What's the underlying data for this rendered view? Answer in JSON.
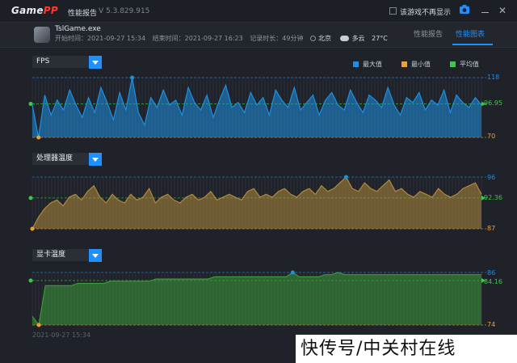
{
  "titlebar": {
    "logo_main": "Game",
    "logo_accent": "PP",
    "app_title": "性能报告",
    "version": "V 5.3.829.915",
    "dont_show_label": "该游戏不再显示",
    "icons": [
      "camera-icon",
      "minimize-icon",
      "close-icon"
    ]
  },
  "session": {
    "game_name": "TslGame.exe",
    "start_time": "开始时间：2021-09-27 15:34",
    "end_time": "结束时间：2021-09-27 16:23",
    "duration": "记录时长：49分钟",
    "city": "北京",
    "weather": "多云",
    "temperature": "27°C"
  },
  "tabs": [
    {
      "label": "性能报告",
      "active": false
    },
    {
      "label": "性能图表",
      "active": true
    }
  ],
  "legend": [
    {
      "label": "最大值",
      "color": "#1e8fe1"
    },
    {
      "label": "最小值",
      "color": "#f0a032"
    },
    {
      "label": "平均值",
      "color": "#3cc84a"
    }
  ],
  "footer_timestamp": "2021-09-27 15:34",
  "watermark": "快传号/中关村在线",
  "chart_data": [
    {
      "type": "area",
      "selector_label": "FPS",
      "color": "#1e8fe1",
      "max": 118,
      "min": 70,
      "avg": 96.95,
      "max_label": "118",
      "min_label": "70",
      "avg_label": "96.95",
      "ylim": [
        70,
        118
      ],
      "values": [
        96,
        70,
        104,
        88,
        100,
        92,
        108,
        96,
        86,
        102,
        90,
        110,
        98,
        84,
        106,
        92,
        118,
        90,
        80,
        102,
        94,
        108,
        96,
        100,
        88,
        110,
        98,
        92,
        104,
        86,
        100,
        112,
        94,
        98,
        90,
        106,
        96,
        102,
        88,
        108,
        100,
        94,
        110,
        92,
        98,
        104,
        88,
        100,
        106,
        96,
        92,
        108,
        98,
        90,
        104,
        100,
        94,
        110,
        96,
        88,
        102,
        98,
        106,
        92,
        100,
        96,
        108,
        90,
        104,
        98,
        94,
        102,
        96
      ]
    },
    {
      "type": "area",
      "selector_label": "处理器温度",
      "color": "#b08a3c",
      "max": 96,
      "min": 87,
      "avg": 92.36,
      "max_label": "96",
      "min_label": "87",
      "avg_label": "92.36",
      "ylim": [
        87,
        96
      ],
      "values": [
        87,
        89,
        90.5,
        91.5,
        92,
        91,
        92.5,
        93,
        92,
        93.5,
        94.5,
        92.5,
        91.5,
        93,
        92,
        91.5,
        93,
        92,
        92.5,
        94,
        91.5,
        92.5,
        93,
        92,
        91.5,
        92.5,
        93,
        92,
        92.5,
        93.5,
        92,
        92.5,
        93,
        92.5,
        92,
        93.5,
        94,
        92.5,
        93,
        92.5,
        93.5,
        94,
        93,
        92.5,
        93.5,
        94,
        93,
        94.5,
        93.5,
        94,
        95,
        96,
        94,
        93.5,
        95,
        94,
        93.5,
        94.5,
        95.5,
        93.5,
        94,
        93,
        92.5,
        93.5,
        93,
        92.5,
        94,
        93,
        92.5,
        93,
        94,
        94.5,
        95,
        93
      ]
    },
    {
      "type": "area",
      "selector_label": "显卡温度",
      "color": "#3a9a3a",
      "max": 86,
      "min": 74,
      "avg": 84.16,
      "max_label": "86",
      "min_label": "74",
      "avg_label": "84.16",
      "ylim": [
        74,
        86
      ],
      "values": [
        76,
        74,
        83,
        83,
        83,
        83,
        83,
        83.5,
        83.5,
        83.5,
        83.5,
        83.5,
        84,
        84,
        84,
        84,
        84,
        84,
        84,
        84.5,
        84.5,
        84.5,
        84.5,
        84.5,
        84.5,
        84.5,
        84.5,
        84.5,
        85,
        85,
        85,
        85,
        85,
        85,
        85,
        85,
        85,
        85,
        85,
        85,
        86,
        85,
        85,
        85,
        85,
        85.5,
        85.5,
        86,
        85.5,
        85.5,
        85.5,
        85.5,
        85.5,
        85.5,
        85.5,
        85.5,
        85.5,
        85.5,
        85.5,
        85.5,
        85.5,
        85.5,
        85.5,
        85.5,
        85.5,
        85.5,
        85.5,
        85.5,
        85.5,
        85.5
      ]
    }
  ]
}
